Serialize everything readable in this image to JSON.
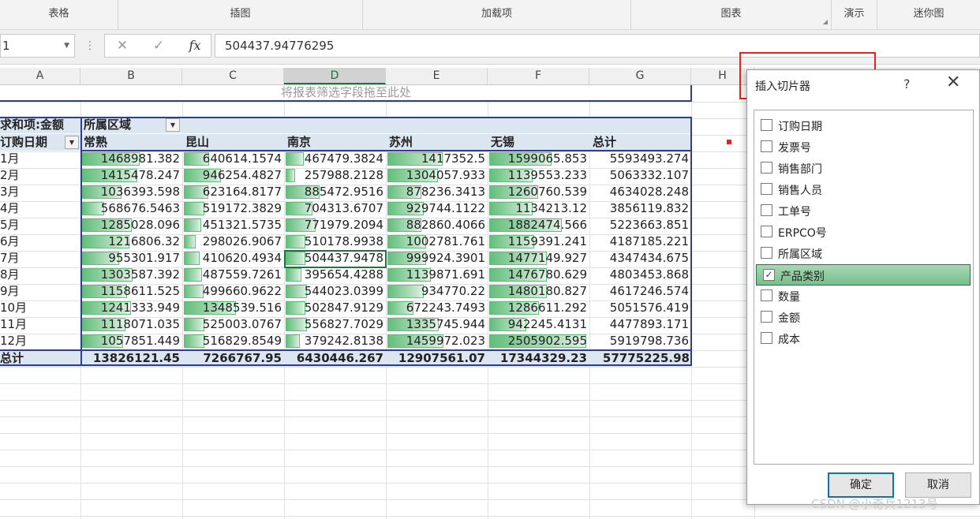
{
  "ribbon": {
    "groups": [
      "表格",
      "插图",
      "加载项",
      "图表",
      "演示",
      "迷你图"
    ],
    "launcher_icon": "dialog-launcher-icon"
  },
  "formula_bar": {
    "name_box": "1",
    "cancel_icon": "✕",
    "enter_icon": "✓",
    "fx_label": "fx",
    "content": "504437.94776295"
  },
  "columns": [
    "A",
    "B",
    "C",
    "D",
    "E",
    "F",
    "G",
    "H"
  ],
  "selected_column": "D",
  "pivot": {
    "filter_hint": "将报表筛选字段拖至此处",
    "value_field": "求和项:金额",
    "column_field": "所属区域",
    "row_field": "订购日期",
    "col_headers": [
      "常熟",
      "昆山",
      "南京",
      "苏州",
      "无锡",
      "总计"
    ],
    "rows": [
      {
        "label": "1月",
        "values": [
          "1468981.382",
          "640614.1574",
          "467479.3824",
          "1417352.5",
          "1599065.853",
          "5593493.274"
        ]
      },
      {
        "label": "2月",
        "values": [
          "1415478.247",
          "946254.4827",
          "257988.2128",
          "1304057.933",
          "1139553.233",
          "5063332.107"
        ]
      },
      {
        "label": "3月",
        "values": [
          "1036393.598",
          "623164.8177",
          "885472.9516",
          "878236.3413",
          "1260760.539",
          "4634028.248"
        ]
      },
      {
        "label": "4月",
        "values": [
          "568676.5463",
          "519172.3829",
          "704313.6707",
          "929744.1122",
          "1134213.12",
          "3856119.832"
        ]
      },
      {
        "label": "5月",
        "values": [
          "1285028.096",
          "451321.5735",
          "771979.2094",
          "882860.4066",
          "1882474.566",
          "5223663.851"
        ]
      },
      {
        "label": "6月",
        "values": [
          "1216806.32",
          "298026.9067",
          "510178.9938",
          "1002781.761",
          "1159391.241",
          "4187185.221"
        ]
      },
      {
        "label": "7月",
        "values": [
          "955301.917",
          "410620.4934",
          "504437.9478",
          "999924.3901",
          "1477149.927",
          "4347434.675"
        ]
      },
      {
        "label": "8月",
        "values": [
          "1303587.392",
          "487559.7261",
          "395654.4288",
          "1139871.691",
          "1476780.629",
          "4803453.868"
        ]
      },
      {
        "label": "9月",
        "values": [
          "1158611.525",
          "499660.9622",
          "544023.0399",
          "934770.22",
          "1480180.827",
          "4617246.574"
        ]
      },
      {
        "label": "10月",
        "values": [
          "1241333.949",
          "1348539.516",
          "502847.9129",
          "672243.7493",
          "1286611.292",
          "5051576.419"
        ]
      },
      {
        "label": "11月",
        "values": [
          "1118071.035",
          "525003.0767",
          "556827.7029",
          "1335745.944",
          "942245.4131",
          "4477893.171"
        ]
      },
      {
        "label": "12月",
        "values": [
          "1057851.449",
          "516829.8549",
          "379242.8138",
          "1459972.023",
          "2505902.595",
          "5919798.736"
        ]
      }
    ],
    "total_label": "总计",
    "totals": [
      "13826121.45",
      "7266767.95",
      "6430446.267",
      "12907561.07",
      "17344329.23",
      "57775225.98"
    ],
    "bar_fill_ratios": [
      [
        0.59,
        0.26,
        0.19,
        0.57,
        0.64
      ],
      [
        0.57,
        0.38,
        0.1,
        0.52,
        0.45
      ],
      [
        0.41,
        0.25,
        0.35,
        0.35,
        0.5
      ],
      [
        0.23,
        0.21,
        0.28,
        0.37,
        0.45
      ],
      [
        0.51,
        0.18,
        0.31,
        0.35,
        0.75
      ],
      [
        0.49,
        0.12,
        0.2,
        0.4,
        0.46
      ],
      [
        0.38,
        0.16,
        0.2,
        0.4,
        0.59
      ],
      [
        0.52,
        0.19,
        0.16,
        0.45,
        0.59
      ],
      [
        0.46,
        0.2,
        0.22,
        0.37,
        0.59
      ],
      [
        0.5,
        0.54,
        0.2,
        0.27,
        0.51
      ],
      [
        0.45,
        0.21,
        0.22,
        0.53,
        0.38
      ],
      [
        0.42,
        0.21,
        0.15,
        0.58,
        1.0
      ]
    ]
  },
  "dialog": {
    "title": "插入切片器",
    "help": "?",
    "close": "✕",
    "fields": [
      {
        "label": "订购日期",
        "checked": false
      },
      {
        "label": "发票号",
        "checked": false
      },
      {
        "label": "销售部门",
        "checked": false
      },
      {
        "label": "销售人员",
        "checked": false
      },
      {
        "label": "工单号",
        "checked": false
      },
      {
        "label": "ERPCO号",
        "checked": false
      },
      {
        "label": "所属区域",
        "checked": false
      },
      {
        "label": "产品类别",
        "checked": true
      },
      {
        "label": "数量",
        "checked": false
      },
      {
        "label": "金额",
        "checked": false
      },
      {
        "label": "成本",
        "checked": false
      }
    ],
    "ok_label": "确定",
    "cancel_label": "取消"
  },
  "colors": {
    "accent": "#217346",
    "pivot_border": "#2f3d9a",
    "databar": "#63be7b",
    "annotation": "#e8231b"
  },
  "watermark": "CSDN @小奇兵1213号"
}
